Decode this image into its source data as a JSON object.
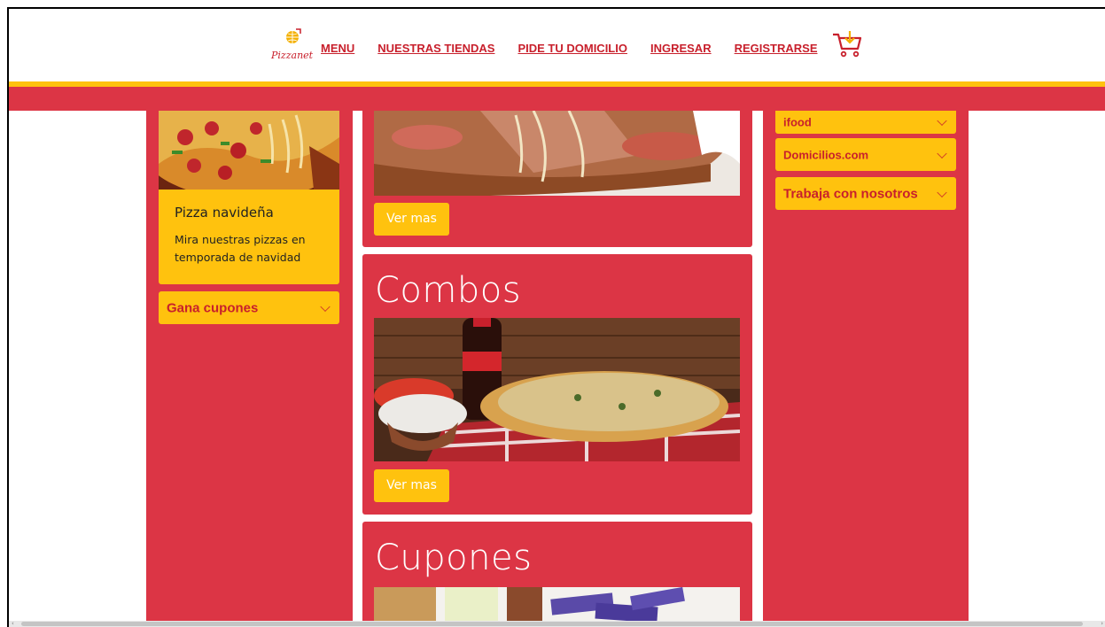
{
  "header": {
    "logo_text": "Pizzanet",
    "nav": [
      "MENU",
      "NUESTRAS TIENDAS",
      "PIDE TU DOMICILIO",
      "INGRESAR",
      "REGISTRARSE"
    ]
  },
  "left": {
    "promo": {
      "title": "Pizza navideña",
      "text": "Mira nuestras pizzas en temporada de navidad"
    },
    "accordion_label": "Gana cupones"
  },
  "main": {
    "card1_button": "Ver mas",
    "card2": {
      "title": "Combos",
      "button": "Ver mas"
    },
    "card3": {
      "title": "Cupones"
    }
  },
  "right": {
    "accordions": [
      "ifood",
      "Domicilios.com",
      "Trabaja con nosotros"
    ]
  },
  "colors": {
    "red": "#dc3545",
    "yellow": "#ffc20e",
    "link_red": "#c8202c"
  }
}
